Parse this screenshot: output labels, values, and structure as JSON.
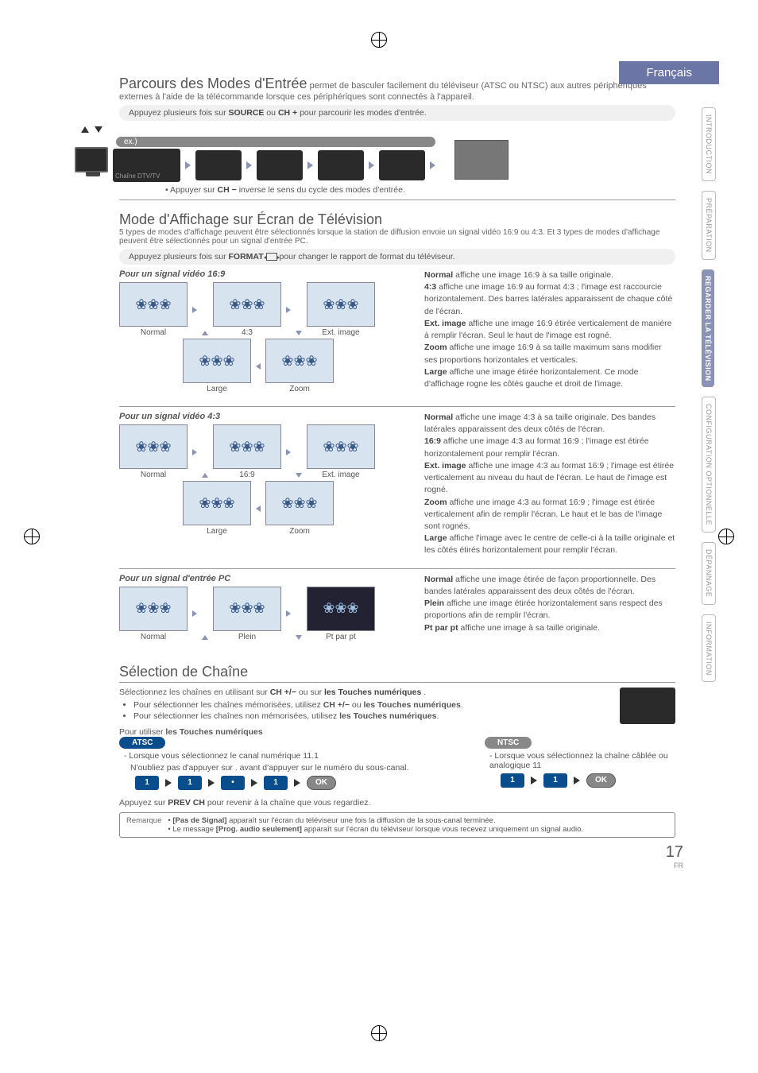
{
  "language_tab": "Français",
  "side_tabs": [
    "INTRODUCTION",
    "PRÉPARATION",
    "REGARDER LA TÉLÉVISION",
    "CONFIGURATION OPTIONNELLE",
    "DÉPANNAGE",
    "INFORMATION"
  ],
  "section1": {
    "title": "Parcours des Modes d'Entrée",
    "lead": " permet de basculer facilement du téléviseur (ATSC ou NTSC) aux autres périphériques externes à l'aide de la télécommande lorsque ces périphériques sont connectés à l'appareil.",
    "instruction_pre": "Appuyez plusieurs fois sur ",
    "instruction_source": "SOURCE",
    "instruction_mid": " ou ",
    "instruction_ch": "CH +",
    "instruction_post": " pour parcourir les modes d'entrée.",
    "ex_label": "ex.)",
    "mode_label": "Chaîne DTV/TV",
    "bullet_pre": "Appuyer sur ",
    "bullet_ch": "CH −",
    "bullet_post": " inverse le sens du cycle des modes d'entrée."
  },
  "section2": {
    "title": "Mode d'Affichage sur Écran de Télévision",
    "note": "5 types de modes d'affichage peuvent être sélectionnés lorsque la station de diffusion envoie un signal vidéo 16:9 ou 4:3. Et 3 types de modes d'affichage peuvent être sélectionnés pour un signal d'entrée PC.",
    "instruction_pre": "Appuyez plusieurs fois sur ",
    "instruction_btn": "FORMAT",
    "instruction_post": " pour changer le rapport de format du téléviseur.",
    "sig169": {
      "title": "Pour un signal vidéo 16:9",
      "labels": {
        "normal": "Normal",
        "a43": "4:3",
        "ext": "Ext. image",
        "large": "Large",
        "zoom": "Zoom"
      },
      "desc": "<b>Normal</b> affiche une image 16:9 à sa taille originale.<br><b>4:3</b> affiche une image 16:9 au format 4:3 ; l'image est raccourcie horizontalement. Des barres latérales apparaissent de chaque côté de l'écran.<br><b>Ext. image</b> affiche une image 16:9 étirée verticalement de manière à remplir l'écran. Seul le haut de l'image est rogné.<br><b>Zoom</b> affiche une image 16:9 à sa taille maximum sans modifier ses proportions horizontales et verticales.<br><b>Large</b> affiche une image étirée horizontalement. Ce mode d'affichage rogne les côtés gauche et droit de l'image."
    },
    "sig43": {
      "title": "Pour un signal vidéo 4:3",
      "labels": {
        "normal": "Normal",
        "a169": "16:9",
        "ext": "Ext. image",
        "large": "Large",
        "zoom": "Zoom"
      },
      "desc": "<b>Normal</b> affiche une image 4:3 à sa taille originale. Des bandes latérales apparaissent des deux côtés de l'écran.<br><b>16:9</b> affiche une image 4:3 au format 16:9 ; l'image est étirée horizontalement pour remplir l'écran.<br><b>Ext. image</b> affiche une image 4:3 au format 16:9 ; l'image est étirée verticalement au niveau du haut de l'écran. Le haut de l'image est rogné.<br><b>Zoom</b> affiche une image 4:3 au format 16:9 ; l'image est étirée verticalement afin de remplir l'écran. Le haut et le bas de l'image sont rognés.<br><b>Large</b> affiche l'image avec le centre de celle-ci à la taille originale et les côtés étirés horizontalement pour remplir l'écran."
    },
    "sigpc": {
      "title": "Pour un signal d'entrée PC",
      "labels": {
        "normal": "Normal",
        "plein": "Plein",
        "ptpt": "Pt par pt"
      },
      "desc": "<b>Normal</b> affiche une image étirée de façon proportionnelle. Des bandes latérales apparaissent des deux côtés de l'écran.<br><b>Plein</b> affiche une image étirée horizontalement sans respect des proportions afin de remplir l'écran.<br><b>Pt par pt</b> affiche une image à sa taille originale."
    }
  },
  "section3": {
    "title": "Sélection de Chaîne",
    "line1_pre": "Sélectionnez les chaînes en utilisant sur ",
    "line1_ch": "CH +/−",
    "line1_mid": " ou sur ",
    "line1_num": "les Touches numériques",
    "line1_post": ".",
    "bullets": [
      "Pour sélectionner les chaînes mémorisées, utilisez <b>CH +/−</b> ou <b>les Touches numériques</b>.",
      "Pour sélectionner les chaînes non mémorisées, utilisez <b>les Touches numériques</b>."
    ],
    "subhead": "Pour utiliser <b>les Touches numériques</b>",
    "atsc_label": "ATSC",
    "ntsc_label": "NTSC",
    "atsc_lines": [
      "Lorsque vous sélectionnez le canal numérique 11.1",
      "N'oubliez pas d'appuyer sur . avant d'appuyer sur le numéro du sous-canal."
    ],
    "ntsc_line": "Lorsque vous sélectionnez la chaîne câblée ou analogique 11",
    "keys": {
      "k1": "1",
      "kdot": "•",
      "ok": "OK"
    },
    "prevch_pre": "Appuyez sur ",
    "prevch_btn": "PREV CH",
    "prevch_post": " pour revenir à la chaîne que vous regardiez.",
    "remark_label": "Remarque",
    "remark1": "<b>[Pas de Signal]</b> apparaît sur l'écran du téléviseur une fois la diffusion de la sous-canal terminée.",
    "remark2": "Le message <b>[Prog. audio seulement]</b> apparaît sur l'écran du téléviseur lorsque vous recevez uniquement un signal audio."
  },
  "page_number": "17",
  "page_lang": "FR"
}
